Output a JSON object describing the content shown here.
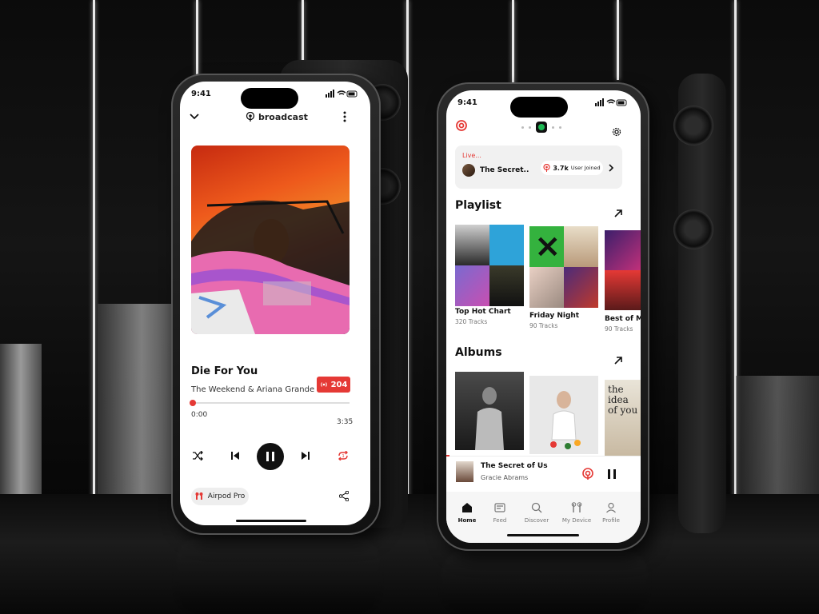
{
  "status_time": "9:41",
  "colors": {
    "accent": "#e53935",
    "dark": "#111111",
    "muted": "#777777"
  },
  "player": {
    "brand": "broadcast",
    "song_title": "Die For You",
    "artist": "The Weekend & Ariana Grande",
    "listeners_badge": "204",
    "elapsed": "0:00",
    "duration": "3:35",
    "progress": 0.01,
    "device_label": "Airpod Pro"
  },
  "home": {
    "live": {
      "label": "Live...",
      "title": "The Secret..",
      "users": "3.7k",
      "users_label": "User Joined"
    },
    "playlist_heading": "Playlist",
    "playlists": [
      {
        "title": "Top Hot Chart",
        "subtitle": "320 Tracks"
      },
      {
        "title": "Friday Night",
        "subtitle": "90 Tracks"
      },
      {
        "title": "Best of M",
        "subtitle": "90 Tracks"
      }
    ],
    "albums_heading": "Albums",
    "album_text": "the idea of you",
    "now_playing": {
      "title": "The Secret of Us",
      "artist": "Gracie Abrams"
    },
    "nav": [
      {
        "label": "Home",
        "icon": "home-icon",
        "active": true
      },
      {
        "label": "Feed",
        "icon": "feed-icon",
        "active": false
      },
      {
        "label": "Discover",
        "icon": "search-icon",
        "active": false
      },
      {
        "label": "My Device",
        "icon": "airpods-icon",
        "active": false
      },
      {
        "label": "Profile",
        "icon": "profile-icon",
        "active": false
      }
    ]
  }
}
